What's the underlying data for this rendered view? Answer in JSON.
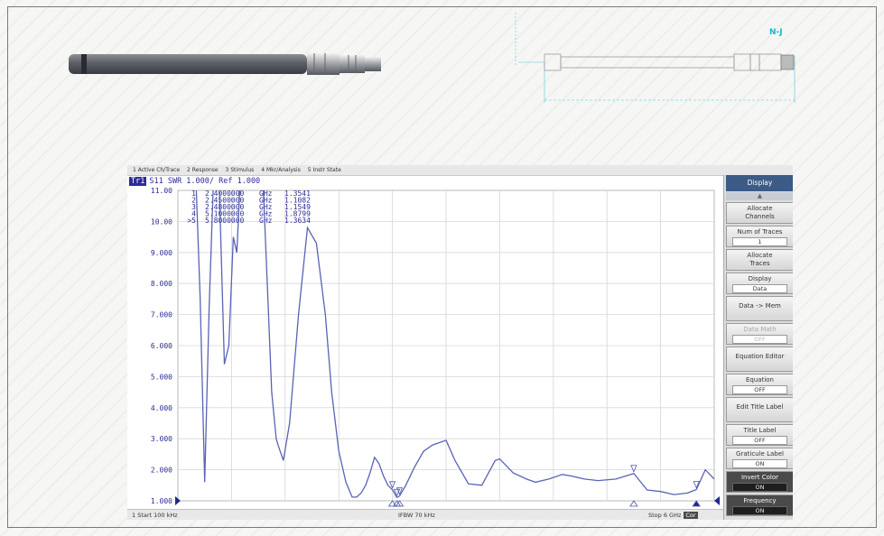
{
  "drawing": {
    "connector_label": "N-J"
  },
  "vna": {
    "menu": [
      "1 Active Ch/Trace",
      "2 Response",
      "3 Stimulus",
      "4 Mkr/Analysis",
      "5 Instr State"
    ],
    "trace_header": {
      "trace": "Tr1",
      "text": "S11  SWR 1.000/ Ref 1.000"
    },
    "markers": [
      {
        "id": "1",
        "freq": "2.4000000",
        "unit": "GHz",
        "value": "1.3541"
      },
      {
        "id": "2",
        "freq": "2.4500000",
        "unit": "GHz",
        "value": "1.1082"
      },
      {
        "id": "3",
        "freq": "2.4800000",
        "unit": "GHz",
        "value": "1.1549"
      },
      {
        "id": "4",
        "freq": "5.1000000",
        "unit": "GHz",
        "value": "1.8799"
      },
      {
        "id": ">5",
        "freq": "5.8000000",
        "unit": "GHz",
        "value": "1.3634"
      }
    ],
    "y_ticks": [
      "11.00",
      "10.00",
      "9.000",
      "8.000",
      "7.000",
      "6.000",
      "5.000",
      "4.000",
      "3.000",
      "2.000",
      "1.000"
    ],
    "status": {
      "start": "1  Start 100 kHz",
      "ifbw": "IFBW 70 kHz",
      "stop": "Stop 6 GHz",
      "badge": "Cor"
    },
    "softkeys": {
      "title": "Display",
      "scroll_up": "▲",
      "items": [
        {
          "label": "Allocate",
          "label2": "Channels"
        },
        {
          "label": "Num of Traces",
          "value": "1"
        },
        {
          "label": "Allocate",
          "label2": "Traces"
        },
        {
          "label": "Display",
          "value": "Data"
        },
        {
          "label": "Data -> Mem"
        },
        {
          "label": "Data Math",
          "value": "OFF"
        },
        {
          "label": "Equation Editor"
        },
        {
          "label": "Equation",
          "value": "OFF"
        },
        {
          "label": "Edit Title Label"
        },
        {
          "label": "Title Label",
          "value": "OFF"
        },
        {
          "label": "Graticule Label",
          "value": "ON"
        },
        {
          "label": "Invert Color",
          "value": "ON"
        },
        {
          "label": "Frequency",
          "value": "ON"
        }
      ]
    }
  },
  "chart_data": {
    "type": "line",
    "title": "",
    "xlabel": "",
    "ylabel": "",
    "xlim": [
      0.0001,
      6
    ],
    "ylim": [
      1,
      11
    ],
    "grid": true,
    "series": [
      {
        "x": [
          0.0001,
          0.05,
          0.1,
          0.2,
          0.25,
          0.3,
          0.35,
          0.4,
          0.42,
          0.46,
          0.52,
          0.57,
          0.62,
          0.66,
          0.7,
          0.74,
          0.78,
          0.82,
          0.85,
          0.88,
          0.9,
          0.93,
          0.95,
          1.0,
          1.05,
          1.1,
          1.12,
          1.18,
          1.25,
          1.35,
          1.45,
          1.55,
          1.65,
          1.72,
          1.8,
          1.88,
          1.95,
          2.0,
          2.05,
          2.1,
          2.15,
          2.2,
          2.25,
          2.3,
          2.35,
          2.4,
          2.45,
          2.48,
          2.55,
          2.65,
          2.75,
          2.85,
          3.0,
          3.1,
          3.25,
          3.4,
          3.55,
          3.6,
          3.75,
          3.9,
          4.0,
          4.15,
          4.3,
          4.4,
          4.55,
          4.7,
          4.9,
          5.1,
          5.25,
          5.4,
          5.55,
          5.7,
          5.8,
          5.9,
          6.0
        ],
        "y": [
          11.5,
          11.5,
          11.5,
          11.5,
          7.5,
          1.6,
          7.2,
          11.5,
          11.5,
          11.5,
          5.4,
          6.0,
          9.5,
          9.0,
          11.5,
          11.5,
          11.5,
          11.5,
          11.5,
          11.5,
          11.5,
          11.5,
          11.5,
          8.0,
          4.5,
          3.0,
          2.8,
          2.3,
          3.5,
          7.0,
          9.8,
          9.3,
          7.0,
          4.5,
          2.6,
          1.6,
          1.12,
          1.12,
          1.25,
          1.5,
          1.9,
          2.4,
          2.2,
          1.8,
          1.5,
          1.354,
          1.108,
          1.155,
          1.5,
          2.1,
          2.6,
          2.8,
          2.95,
          2.3,
          1.55,
          1.5,
          2.3,
          2.35,
          1.9,
          1.7,
          1.6,
          1.7,
          1.85,
          1.8,
          1.7,
          1.65,
          1.7,
          1.88,
          1.35,
          1.3,
          1.2,
          1.25,
          1.363,
          2.0,
          1.7
        ]
      }
    ]
  }
}
